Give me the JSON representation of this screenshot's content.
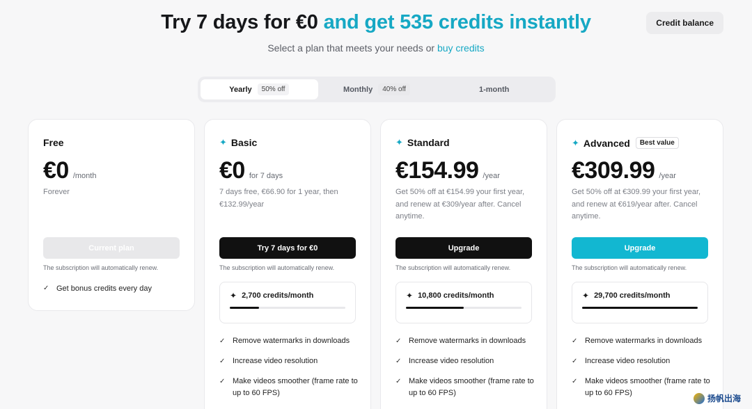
{
  "header": {
    "headline_main": "Try 7 days for €0",
    "headline_accent": "and get 535 credits instantly",
    "sub_text": "Select a plan that meets your needs or",
    "sub_link": "buy credits",
    "credit_balance": "Credit balance"
  },
  "billing_toggle": [
    {
      "label": "Yearly",
      "badge": "50% off",
      "active": true
    },
    {
      "label": "Monthly",
      "badge": "40% off",
      "active": false
    },
    {
      "label": "1-month",
      "badge": "",
      "active": false
    }
  ],
  "plans": [
    {
      "name": "Free",
      "price": "€0",
      "suffix": "/month",
      "desc": "Forever",
      "cta": "Current plan",
      "renew": "The subscription will automatically renew.",
      "features": [
        "Get bonus credits every day"
      ]
    },
    {
      "name": "Basic",
      "price": "€0",
      "suffix": "for 7 days",
      "desc": "7 days free, €66.90 for 1 year, then €132.99/year",
      "cta": "Try 7 days for €0",
      "renew": "The subscription will automatically renew.",
      "credits": "2,700 credits/month",
      "credits_level": 0.25,
      "features": [
        "Remove watermarks in downloads",
        "Increase video resolution",
        "Make videos smoother (frame rate to up to 60 FPS)"
      ]
    },
    {
      "name": "Standard",
      "price": "€154.99",
      "suffix": "/year",
      "desc": "Get 50% off at €154.99 your first year, and renew at €309/year after. Cancel anytime.",
      "cta": "Upgrade",
      "renew": "The subscription will automatically renew.",
      "credits": "10,800 credits/month",
      "credits_level": 0.5,
      "features": [
        "Remove watermarks in downloads",
        "Increase video resolution",
        "Make videos smoother (frame rate to up to 60 FPS)"
      ]
    },
    {
      "name": "Advanced",
      "badge": "Best value",
      "price": "€309.99",
      "suffix": "/year",
      "desc": "Get 50% off at €309.99 your first year, and renew at €619/year after. Cancel anytime.",
      "cta": "Upgrade",
      "renew": "The subscription will automatically renew.",
      "credits": "29,700 credits/month",
      "credits_level": 1.0,
      "features": [
        "Remove watermarks in downloads",
        "Increase video resolution",
        "Make videos smoother (frame rate to up to 60 FPS)"
      ]
    }
  ],
  "watermark": "扬帆出海",
  "colors": {
    "accent": "#16a8c4",
    "cta_teal": "#12b7d1",
    "cta_dark": "#111111"
  }
}
